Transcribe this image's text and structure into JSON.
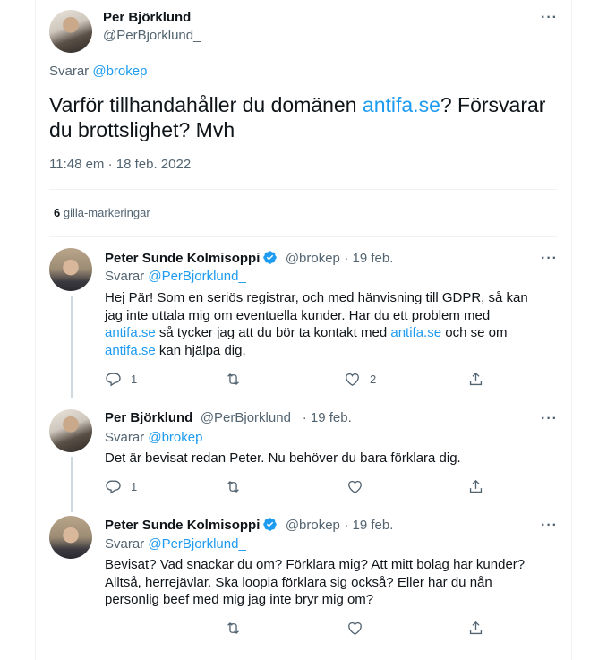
{
  "main_tweet": {
    "author_name": "Per Björklund",
    "author_handle": "@PerBjorklund_",
    "replying_prefix": "Svarar ",
    "replying_to": "@brokep",
    "text_part1": "Varför tillhandahåller du domänen ",
    "text_link": "antifa.se",
    "text_part2": "? Försvarar du brottslighet? Mvh",
    "timestamp": "11:48 em · 18 feb. 2022",
    "likes_count": "6",
    "likes_label": " gilla-markeringar"
  },
  "replies": [
    {
      "author_name": "Peter Sunde Kolmisoppi",
      "author_handle": "@brokep",
      "date": "· 19 feb.",
      "replying_prefix": "Svarar ",
      "replying_to": "@PerBjorklund_",
      "text_a": "Hej Pär! Som en seriös registrar, och med hänvisning till GDPR, så kan jag inte uttala mig om eventuella kunder. Har du ett problem med ",
      "link_1": "antifa.se",
      "text_b": " så tycker jag att du bör ta kontakt med ",
      "link_2": "antifa.se",
      "text_c": " och se om ",
      "link_3": "antifa.se",
      "text_d": " kan hjälpa dig.",
      "reply_count": "1",
      "like_count": "2"
    },
    {
      "author_name": "Per Björklund",
      "author_handle": "@PerBjorklund_",
      "date": "· 19 feb.",
      "replying_prefix": "Svarar ",
      "replying_to": "@brokep",
      "text": "Det är bevisat redan Peter. Nu behöver du bara förklara dig.",
      "reply_count": "1"
    },
    {
      "author_name": "Peter Sunde Kolmisoppi",
      "author_handle": "@brokep",
      "date": "· 19 feb.",
      "replying_prefix": "Svarar ",
      "replying_to": "@PerBjorklund_",
      "text": "Bevisat? Vad snackar du om? Förklara mig? Att mitt bolag har kunder? Alltså, herrejävlar. Ska loopia förklara sig också? Eller har du nån personlig beef med mig jag inte bryr mig om?"
    }
  ],
  "icons": [
    "more-icon",
    "reply-icon",
    "retweet-icon",
    "like-icon",
    "share-icon",
    "verified-icon"
  ],
  "colors": {
    "link": "#1d9bf0",
    "muted": "#536471",
    "text": "#0f1419",
    "divider": "#eff3f4"
  }
}
